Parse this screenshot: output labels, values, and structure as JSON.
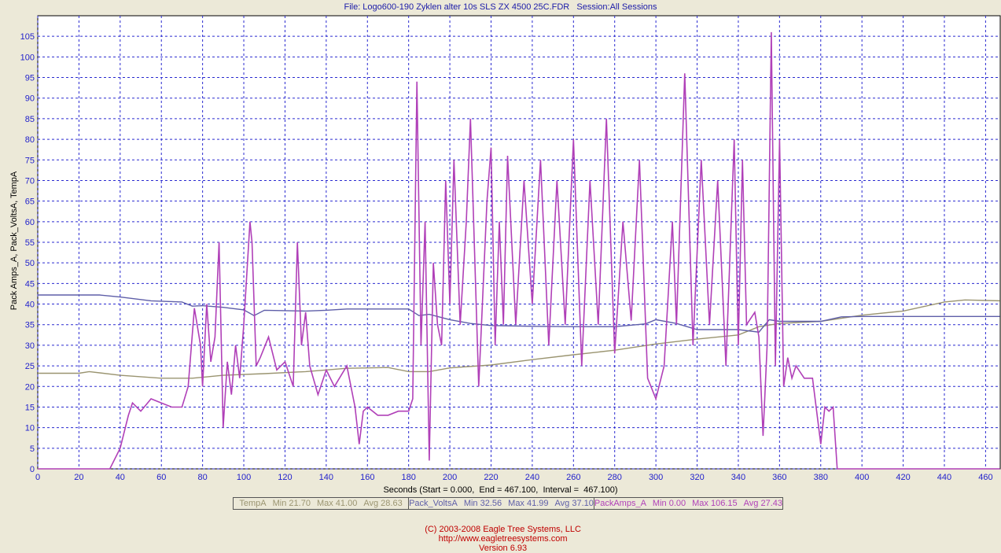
{
  "header": {
    "title": "File: Logo600-190 Zyklen alter 10s SLS ZX 4500 25C.FDR   Session:All Sessions"
  },
  "colors": {
    "plot_bg": "#ffffff",
    "grid": "#2a2ad0",
    "frame_bg": "#ece9d8",
    "tick_text": "#2222cc",
    "temp": "#9a9470",
    "volts": "#5e5ea8",
    "amps": "#b040b8",
    "footer": "#c00000"
  },
  "chart_data": {
    "type": "line",
    "title": "File: Logo600-190 Zyklen alter 10s SLS ZX 4500 25C.FDR   Session:All Sessions",
    "xlabel": "Seconds (Start = 0.000,  End = 467.100,  Interval =  467.100)",
    "ylabel": "Pack Amps_A, Pack_VoltsA, TempA",
    "xlim": [
      0,
      467.1
    ],
    "ylim": [
      0,
      110
    ],
    "xticks": [
      0,
      20,
      40,
      60,
      80,
      100,
      120,
      140,
      160,
      180,
      200,
      220,
      240,
      260,
      280,
      300,
      320,
      340,
      360,
      380,
      400,
      420,
      440,
      460
    ],
    "yticks": [
      0,
      5,
      10,
      15,
      20,
      25,
      30,
      35,
      40,
      45,
      50,
      55,
      60,
      65,
      70,
      75,
      80,
      85,
      90,
      95,
      100,
      105
    ],
    "grid": true,
    "legend_position": "bottom",
    "series": [
      {
        "name": "TempA",
        "stats": {
          "min": "21.70",
          "max": "41.00",
          "avg": "28.63"
        },
        "x": [
          0,
          20,
          25,
          40,
          60,
          75,
          90,
          110,
          130,
          150,
          170,
          180,
          190,
          200,
          220,
          240,
          260,
          280,
          300,
          320,
          340,
          350,
          360,
          380,
          400,
          420,
          440,
          450,
          467
        ],
        "y": [
          23.2,
          23.2,
          23.6,
          22.7,
          22.0,
          22.0,
          22.7,
          23.1,
          23.6,
          24.4,
          24.6,
          23.6,
          23.6,
          24.5,
          25.2,
          26.5,
          27.7,
          28.8,
          30.3,
          31.5,
          32.5,
          34.5,
          35.3,
          35.8,
          37.3,
          38.3,
          40.5,
          41.0,
          40.8
        ]
      },
      {
        "name": "Pack_VoltsA",
        "stats": {
          "min": "32.56",
          "max": "41.99",
          "avg": "37.10"
        },
        "x": [
          0,
          30,
          40,
          55,
          70,
          75,
          80,
          90,
          100,
          105,
          110,
          130,
          140,
          150,
          160,
          170,
          180,
          185,
          190,
          200,
          210,
          220,
          240,
          260,
          280,
          295,
          300,
          310,
          320,
          340,
          350,
          355,
          360,
          380,
          390,
          400,
          420,
          440,
          467
        ],
        "y": [
          42.2,
          42.2,
          41.7,
          40.8,
          40.5,
          39.5,
          39.6,
          39.2,
          38.6,
          37.2,
          38.5,
          38.3,
          38.5,
          38.8,
          38.8,
          38.8,
          38.8,
          37.2,
          37.5,
          36.2,
          35.3,
          34.8,
          34.6,
          34.5,
          34.5,
          35.2,
          36.2,
          35.3,
          33.8,
          33.8,
          33.2,
          36.2,
          35.8,
          35.8,
          36.9,
          37.0,
          37.0,
          37.0,
          37.0
        ]
      },
      {
        "name": "PackAmps_A",
        "stats": {
          "min": "0.00",
          "max": "106.15",
          "avg": "27.43"
        },
        "x": [
          0,
          35,
          40,
          44,
          46,
          50,
          55,
          60,
          65,
          70,
          73,
          76,
          79,
          80,
          82,
          84,
          86,
          88,
          90,
          92,
          94,
          96,
          98,
          100,
          103,
          104,
          106,
          108,
          112,
          116,
          120,
          124,
          126,
          128,
          130,
          132,
          136,
          140,
          144,
          150,
          154,
          156,
          158,
          160,
          165,
          170,
          175,
          180,
          182,
          184,
          186,
          188,
          190,
          192,
          194,
          196,
          198,
          200,
          202,
          205,
          208,
          210,
          214,
          218,
          220,
          222,
          224,
          226,
          228,
          232,
          236,
          240,
          244,
          248,
          252,
          256,
          260,
          264,
          268,
          272,
          276,
          280,
          284,
          288,
          292,
          296,
          300,
          304,
          308,
          310,
          314,
          318,
          322,
          326,
          330,
          334,
          338,
          340,
          342,
          344,
          348,
          350,
          352,
          354,
          356,
          358,
          360,
          362,
          364,
          366,
          368,
          372,
          376,
          380,
          382,
          384,
          386,
          388,
          400,
          420,
          440,
          467
        ],
        "y": [
          0,
          0,
          5,
          13,
          16,
          14,
          17,
          16,
          15,
          15,
          20,
          39,
          30,
          20,
          40,
          26,
          32,
          55,
          10,
          26,
          18,
          30,
          22,
          35,
          60,
          55,
          25,
          27,
          32,
          24,
          26,
          20,
          55,
          30,
          38,
          25,
          18,
          24,
          20,
          25,
          15,
          6,
          14,
          15,
          13,
          13,
          14,
          14,
          17,
          94,
          30,
          60,
          2,
          50,
          35,
          30,
          70,
          40,
          75,
          35,
          60,
          85,
          20,
          65,
          78,
          30,
          60,
          35,
          76,
          35,
          70,
          40,
          75,
          30,
          70,
          35,
          80,
          25,
          70,
          35,
          85,
          28,
          60,
          36,
          75,
          22,
          17,
          25,
          60,
          35,
          96,
          30,
          75,
          35,
          70,
          25,
          80,
          30,
          75,
          35,
          38,
          32,
          8,
          30,
          106,
          25,
          80,
          20,
          27,
          22,
          25,
          22,
          22,
          6,
          15,
          14,
          15,
          0,
          0,
          0,
          0,
          0
        ]
      }
    ]
  },
  "legend": {
    "items": [
      {
        "name": "TempA",
        "min_label": "Min",
        "min": "21.70",
        "max_label": "Max",
        "max": "41.00",
        "avg_label": "Avg",
        "avg": "28.63"
      },
      {
        "name": "Pack_VoltsA",
        "min_label": "Min",
        "min": "32.56",
        "max_label": "Max",
        "max": "41.99",
        "avg_label": "Avg",
        "avg": "37.10"
      },
      {
        "name": "PackAmps_A",
        "min_label": "Min",
        "min": "0.00",
        "max_label": "Max",
        "max": "106.15",
        "avg_label": "Avg",
        "avg": "27.43"
      }
    ]
  },
  "footer": {
    "copyright": "(C) 2003-2008 Eagle Tree Systems, LLC",
    "url": "http://www.eagletreesystems.com",
    "version": "Version 6.93"
  }
}
